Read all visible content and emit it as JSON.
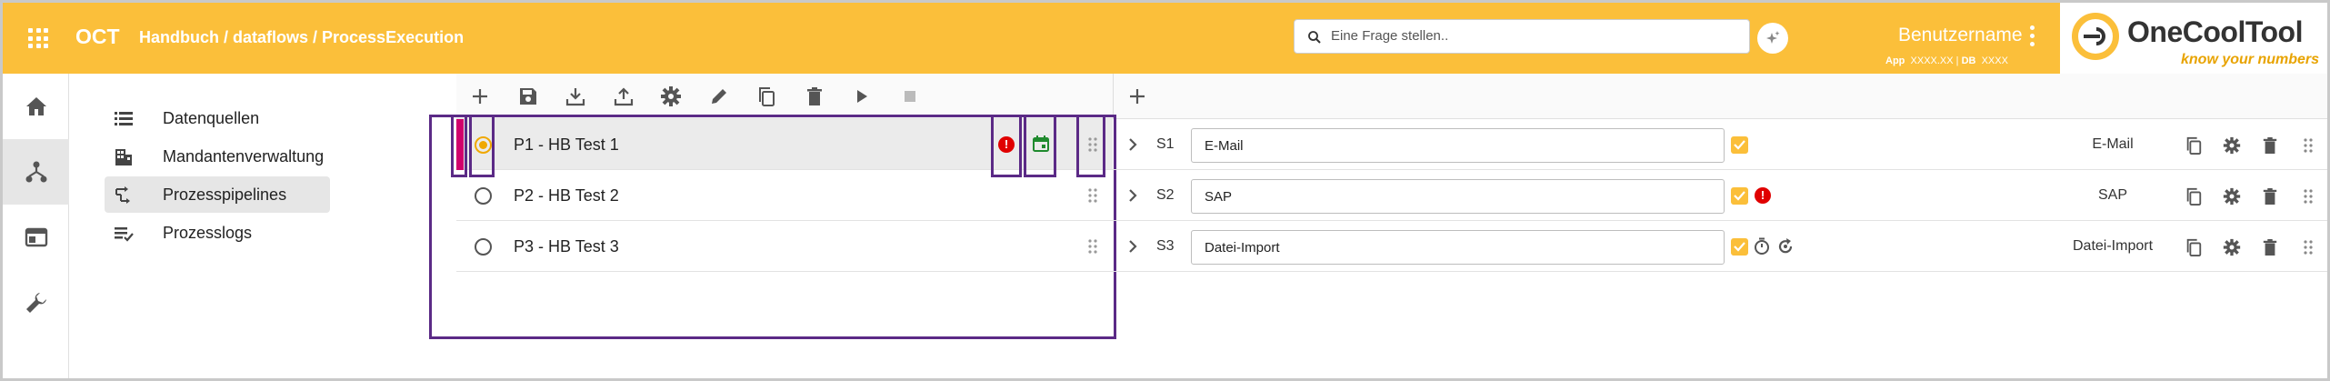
{
  "header": {
    "brand": "OCT",
    "breadcrumb": "Handbuch / dataflows / ProcessExecution",
    "search_placeholder": "Eine Frage stellen..",
    "username": "Benutzername",
    "app_label": "App",
    "app_value": "XXXX.XX",
    "db_label": "DB",
    "db_value": "XXXX",
    "logo_text": "OneCoolTool",
    "logo_tagline": "know your numbers",
    "accent_color": "#fbbf3a"
  },
  "rail": {
    "items": [
      {
        "icon": "home-icon"
      },
      {
        "icon": "dataflow-icon",
        "active": true
      },
      {
        "icon": "window-icon"
      },
      {
        "icon": "wrench-icon"
      }
    ]
  },
  "menu": {
    "items": [
      {
        "label": "Datenquellen",
        "icon": "list-icon"
      },
      {
        "label": "Mandantenverwaltung",
        "icon": "building-icon"
      },
      {
        "label": "Prozesspipelines",
        "icon": "pipeline-icon",
        "active": true
      },
      {
        "label": "Prozesslogs",
        "icon": "log-icon"
      }
    ]
  },
  "toolbar": {
    "buttons": [
      "add-icon",
      "save-icon",
      "download-icon",
      "upload-icon",
      "settings-icon",
      "edit-icon",
      "copy-icon",
      "delete-icon",
      "play-icon",
      "stop-icon"
    ],
    "step_add": "add-icon"
  },
  "pipelines": [
    {
      "label": "P1 - HB Test 1",
      "selected": true,
      "error": "!",
      "scheduled": true
    },
    {
      "label": "P2 - HB Test 2",
      "selected": false
    },
    {
      "label": "P3 - HB Test 3",
      "selected": false
    }
  ],
  "steps": [
    {
      "id": "S1",
      "name": "E-Mail",
      "type": "E-Mail",
      "checked": true
    },
    {
      "id": "S2",
      "name": "SAP",
      "type": "SAP",
      "checked": true,
      "error": "!"
    },
    {
      "id": "S3",
      "name": "Datei-Import",
      "type": "Datei-Import",
      "checked": true,
      "timer": true,
      "rerun": true
    }
  ]
}
